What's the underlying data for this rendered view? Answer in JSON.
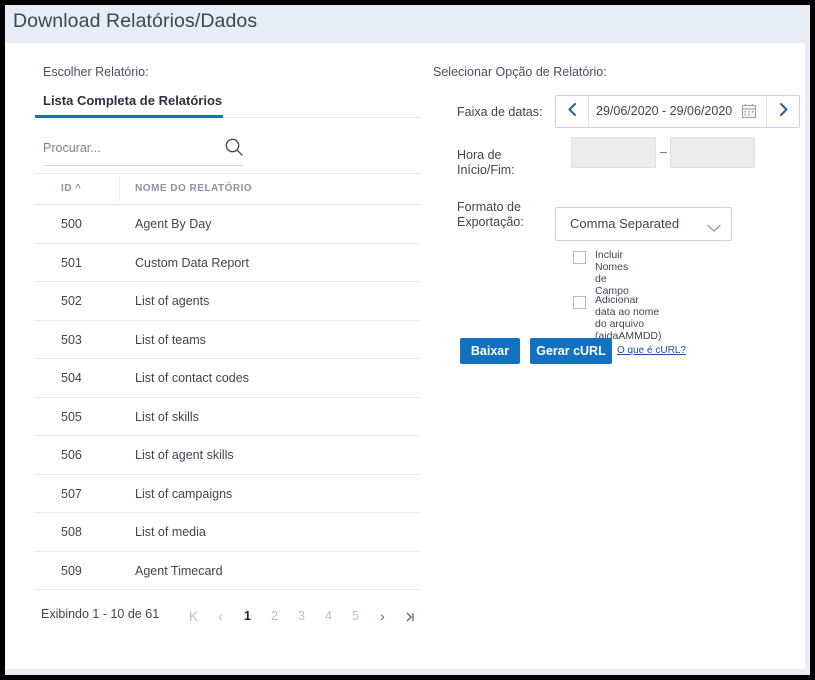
{
  "window": {
    "title": "Download Relatórios/Dados"
  },
  "left": {
    "section_label": "Escolher Relatório:",
    "tab": {
      "label": "Lista Completa de Relatórios"
    },
    "search": {
      "placeholder": "Procurar...",
      "value": "",
      "icon": "search-icon"
    },
    "table": {
      "columns": [
        "ID",
        "NOME DO RELATÓRIO"
      ],
      "sort": {
        "column": "ID",
        "direction": "asc",
        "indicator": "^"
      },
      "rows": [
        {
          "id": "500",
          "name": "Agent By Day"
        },
        {
          "id": "501",
          "name": "Custom Data Report"
        },
        {
          "id": "502",
          "name": "List of agents"
        },
        {
          "id": "503",
          "name": "List of teams"
        },
        {
          "id": "504",
          "name": "List of contact codes"
        },
        {
          "id": "505",
          "name": "List of skills"
        },
        {
          "id": "506",
          "name": "List of agent skills"
        },
        {
          "id": "507",
          "name": "List of campaigns"
        },
        {
          "id": "508",
          "name": "List of media"
        },
        {
          "id": "509",
          "name": "Agent Timecard"
        }
      ]
    },
    "pagination": {
      "info": "Exibindo 1 - 10 de 61",
      "first": "K",
      "prev": "‹",
      "next": "›",
      "last": "»",
      "pages": [
        "1",
        "2",
        "3",
        "4",
        "5"
      ],
      "current_page": "1"
    }
  },
  "right": {
    "section_label": "Selecionar Opção de Relatório:",
    "date_range": {
      "label": "Faixa de datas:",
      "value": "29/06/2020 - 29/06/2020",
      "prev_icon": "chevron-left-icon",
      "next_icon": "chevron-right-icon",
      "calendar_icon": "calendar-icon"
    },
    "time": {
      "label": "Hora de\nInício/Fim:",
      "start_value": "",
      "end_value": "",
      "separator": "–"
    },
    "export_format": {
      "label": "Formato de\nExportação:",
      "selected": "Comma Separated",
      "options": [
        "Comma Separated"
      ],
      "chevron_icon": "chevron-down-icon"
    },
    "checkboxes": [
      {
        "label": "Incluir Nomes de Campo",
        "checked": false
      },
      {
        "label": "Adicionar data ao nome do arquivo\n(aidaAMMDD)",
        "checked": false
      }
    ],
    "actions": {
      "download_label": "Baixar",
      "curl_label": "Gerar cURL",
      "curl_link_label": "O que é cURL?"
    }
  },
  "colors": {
    "accent_blue": "#1271c0",
    "title_band": "#e7edf6",
    "link_blue": "#1a4fa0",
    "text_primary": "#3d4652",
    "text_muted": "#8a93a3"
  }
}
